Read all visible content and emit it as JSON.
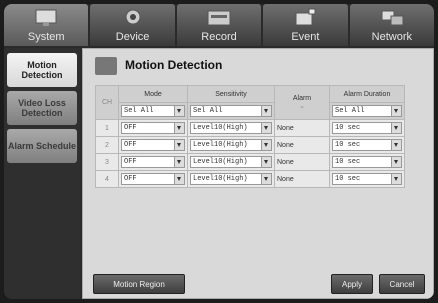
{
  "tabs": [
    {
      "label": "System",
      "icon": "monitor-icon",
      "active": true
    },
    {
      "label": "Device",
      "icon": "camera-icon",
      "active": false
    },
    {
      "label": "Record",
      "icon": "record-icon",
      "active": false
    },
    {
      "label": "Event",
      "icon": "event-icon",
      "active": false
    },
    {
      "label": "Network",
      "icon": "network-icon",
      "active": false
    }
  ],
  "side": {
    "items": [
      {
        "label": "Motion Detection",
        "active": true
      },
      {
        "label": "Video Loss Detection",
        "active": false
      },
      {
        "label": "Alarm Schedule",
        "active": false
      }
    ]
  },
  "main": {
    "title": "Motion Detection",
    "headers": {
      "ch": "CH",
      "mode": "Mode",
      "sensitivity": "Sensitivity",
      "alarm": "Alarm",
      "duration": "Alarm Duration"
    },
    "all_row": {
      "mode": "Sel All",
      "sensitivity": "Sel All",
      "duration": "Sel All"
    },
    "rows": [
      {
        "ch": "1",
        "mode": "OFF",
        "sensitivity": "Level10(High)",
        "alarm": "None",
        "duration": "10 sec"
      },
      {
        "ch": "2",
        "mode": "OFF",
        "sensitivity": "Level10(High)",
        "alarm": "None",
        "duration": "10 sec"
      },
      {
        "ch": "3",
        "mode": "OFF",
        "sensitivity": "Level10(High)",
        "alarm": "None",
        "duration": "10 sec"
      },
      {
        "ch": "4",
        "mode": "OFF",
        "sensitivity": "Level10(High)",
        "alarm": "None",
        "duration": "10 sec"
      }
    ],
    "buttons": {
      "motion_region": "Motion Region",
      "apply": "Apply",
      "cancel": "Cancel"
    }
  }
}
